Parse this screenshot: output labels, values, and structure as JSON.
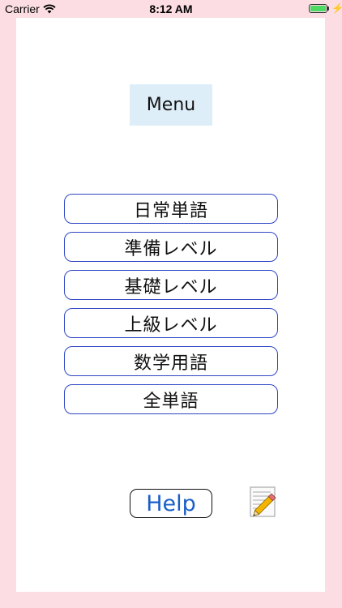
{
  "status_bar": {
    "carrier": "Carrier",
    "time": "8:12 AM",
    "icons": [
      "wifi-icon",
      "battery-icon",
      "charging-icon"
    ]
  },
  "menu": {
    "title": "Menu",
    "items": [
      {
        "label": "日常単語"
      },
      {
        "label": "準備レベル"
      },
      {
        "label": "基礎レベル"
      },
      {
        "label": "上級レベル"
      },
      {
        "label": "数学用語"
      },
      {
        "label": "全単語"
      }
    ]
  },
  "footer": {
    "help_label": "Help",
    "notes_icon": "notepad-pencil-icon"
  },
  "colors": {
    "background": "#fcdde3",
    "title_bg": "#deeef8",
    "button_border": "#2e46c4",
    "help_text": "#1a5fc7"
  }
}
